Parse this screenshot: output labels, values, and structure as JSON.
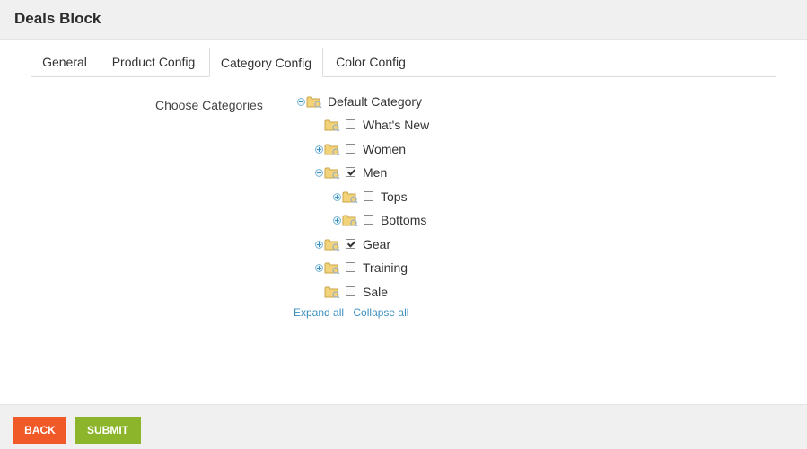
{
  "header": {
    "title": "Deals Block"
  },
  "tabs": [
    {
      "label": "General",
      "active": false
    },
    {
      "label": "Product Config",
      "active": false
    },
    {
      "label": "Category Config",
      "active": true
    },
    {
      "label": "Color Config",
      "active": false
    }
  ],
  "form": {
    "categories_label": "Choose Categories"
  },
  "tree": {
    "root": {
      "label": "Default Category",
      "toggle": "minus-icon"
    },
    "items": [
      {
        "label": "What's New",
        "checked": false,
        "toggle": null
      },
      {
        "label": "Women",
        "checked": false,
        "toggle": "plus-icon"
      },
      {
        "label": "Men",
        "checked": true,
        "toggle": "minus-icon"
      },
      {
        "label": "Tops",
        "checked": false,
        "toggle": "plus-icon"
      },
      {
        "label": "Bottoms",
        "checked": false,
        "toggle": "plus-icon"
      },
      {
        "label": "Gear",
        "checked": true,
        "toggle": "plus-icon"
      },
      {
        "label": "Training",
        "checked": false,
        "toggle": "plus-icon"
      },
      {
        "label": "Sale",
        "checked": false,
        "toggle": null
      }
    ],
    "expand_all": "Expand all",
    "collapse_all": "Collapse all"
  },
  "footer": {
    "back_label": "BACK",
    "submit_label": "SUBMIT"
  },
  "colors": {
    "back_button": "#f05a28",
    "submit_button": "#8cb52b",
    "link": "#3d8fbf",
    "folder": "#f3d37a"
  },
  "icons": {
    "folder": "folder-icon",
    "expand": "plus-icon",
    "collapse": "minus-icon"
  }
}
